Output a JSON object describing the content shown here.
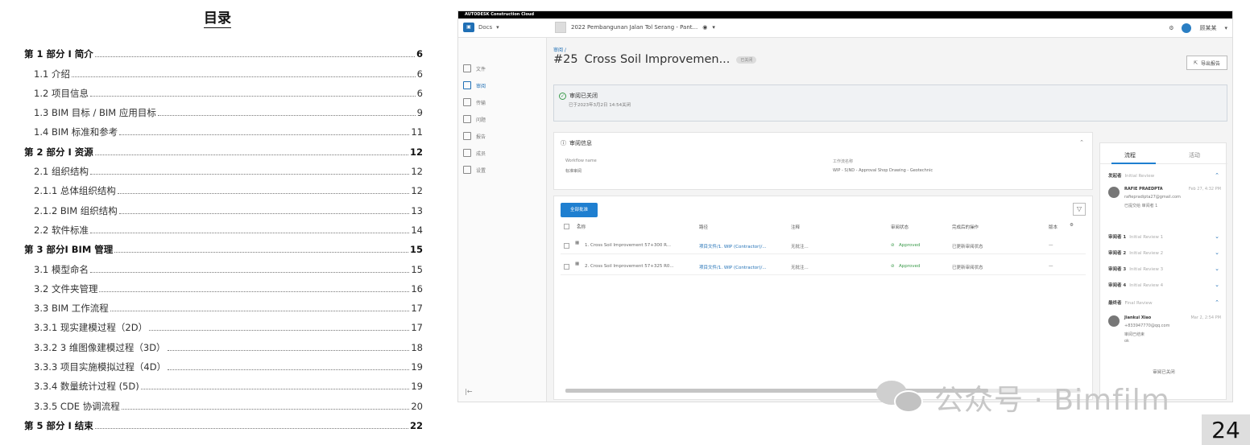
{
  "toc": {
    "title": "目录",
    "entries": [
      {
        "text": "第 1 部分 I 简介",
        "page": "6",
        "level": 0
      },
      {
        "text": "1.1 介绍",
        "page": "6",
        "level": 1
      },
      {
        "text": "1.2 项目信息",
        "page": "6",
        "level": 1
      },
      {
        "text": "1.3 BIM 目标 / BIM 应用目标",
        "page": "9",
        "level": 1
      },
      {
        "text": "1.4 BIM 标准和参考",
        "page": "11",
        "level": 1
      },
      {
        "text": "第 2 部分 I 资源",
        "page": "12",
        "level": 0
      },
      {
        "text": "2.1   组织结构",
        "page": "12",
        "level": 1
      },
      {
        "text": "2.1.1 总体组织结构",
        "page": "12",
        "level": 1
      },
      {
        "text": "2.1.2 BIM 组织结构",
        "page": "13",
        "level": 1
      },
      {
        "text": "2.2   软件标准",
        "page": "14",
        "level": 1
      },
      {
        "text": "第 3 部分I BIM 管理",
        "page": "15",
        "level": 0
      },
      {
        "text": "3.1 模型命名",
        "page": "15",
        "level": 1
      },
      {
        "text": "3.2 文件夹管理",
        "page": "16",
        "level": 1
      },
      {
        "text": "3.3 BIM 工作流程",
        "page": "17",
        "level": 1
      },
      {
        "text": "3.3.1 现实建模过程（2D）",
        "page": "17",
        "level": 1
      },
      {
        "text": "3.3.2 3 维图像建模过程（3D）",
        "page": "18",
        "level": 1
      },
      {
        "text": "3.3.3 项目实施模拟过程（4D）",
        "page": "19",
        "level": 1
      },
      {
        "text": "3.3.4 数量统计过程 (5D)",
        "page": "19",
        "level": 1
      },
      {
        "text": "3.3.5 CDE 协调流程",
        "page": "20",
        "level": 1
      },
      {
        "text": "第 5 部分 I 结束",
        "page": "22",
        "level": 0
      }
    ]
  },
  "acc": {
    "topbar": "AUTODESK Construction Cloud",
    "docs_label": "Docs",
    "project_name": "2022 Pembangunan Jalan Tol Serang - Pant...",
    "user_label": "顾某某",
    "nav": [
      "文件",
      "审阅",
      "传输",
      "问题",
      "报告",
      "成员",
      "设置"
    ],
    "breadcrumb": "审阅 /",
    "review_number": "#25",
    "review_title": "Cross Soil Improvemen...",
    "status_badge": "已关闭",
    "export_label": "导出报告",
    "banner_title": "审阅已关闭",
    "banner_sub": "已于2023年3月2日 14:54关闭",
    "info_title": "审阅信息",
    "info_col1_label": "Workflow name",
    "info_col1_value": "标准审阅",
    "info_col2_label": "工作流名称",
    "info_col2_value": "WIP - S(ND - Approval Shop Drawing - Geotechnic",
    "btn_all": "全部批准",
    "columns": [
      "名称",
      "路径",
      "注释",
      "审阅状态",
      "完成后的操作",
      "版本"
    ],
    "rows": [
      {
        "name": "1. Cross Soil Improvement 57+300 R...",
        "path": "项目文件/1. WIP (Contractor)/...",
        "note": "无批注...",
        "status": "Approved",
        "action": "已更新审阅状态",
        "ver": "—"
      },
      {
        "name": "2. Cross Soil Improvement 57+325 R0...",
        "path": "项目文件/1. WIP (Contractor)/...",
        "note": "无批注...",
        "status": "Approved",
        "action": "已更新审阅状态",
        "ver": "—"
      }
    ],
    "right_tabs": [
      "流程",
      "活动"
    ],
    "steps": [
      {
        "label": "发起者",
        "detail": "Initial Review"
      },
      {
        "label": "审阅者 1",
        "detail": "Initial Review 1"
      },
      {
        "label": "审阅者 2",
        "detail": "Initial Review 2"
      },
      {
        "label": "审阅者 3",
        "detail": "Initial Review 3"
      },
      {
        "label": "审阅者 4",
        "detail": "Initial Review 4"
      },
      {
        "label": "最终者",
        "detail": "Final Review"
      }
    ],
    "person1": {
      "name": "RAFIE PRAEDPTA",
      "time": "Feb 27, 4:32 PM",
      "email": "rafiepradipta27@gmail.com",
      "note": "已提交给 审阅者 1"
    },
    "person2": {
      "name": "Jiankui Xiao",
      "time": "Mar 2, 2:54 PM",
      "email": "+833947770@qq.com",
      "note": "审阅已结束",
      "note2": "ok"
    },
    "history_label": "审阅已关闭"
  },
  "watermark": "公众号 · Bimfilm",
  "page_number": "24"
}
